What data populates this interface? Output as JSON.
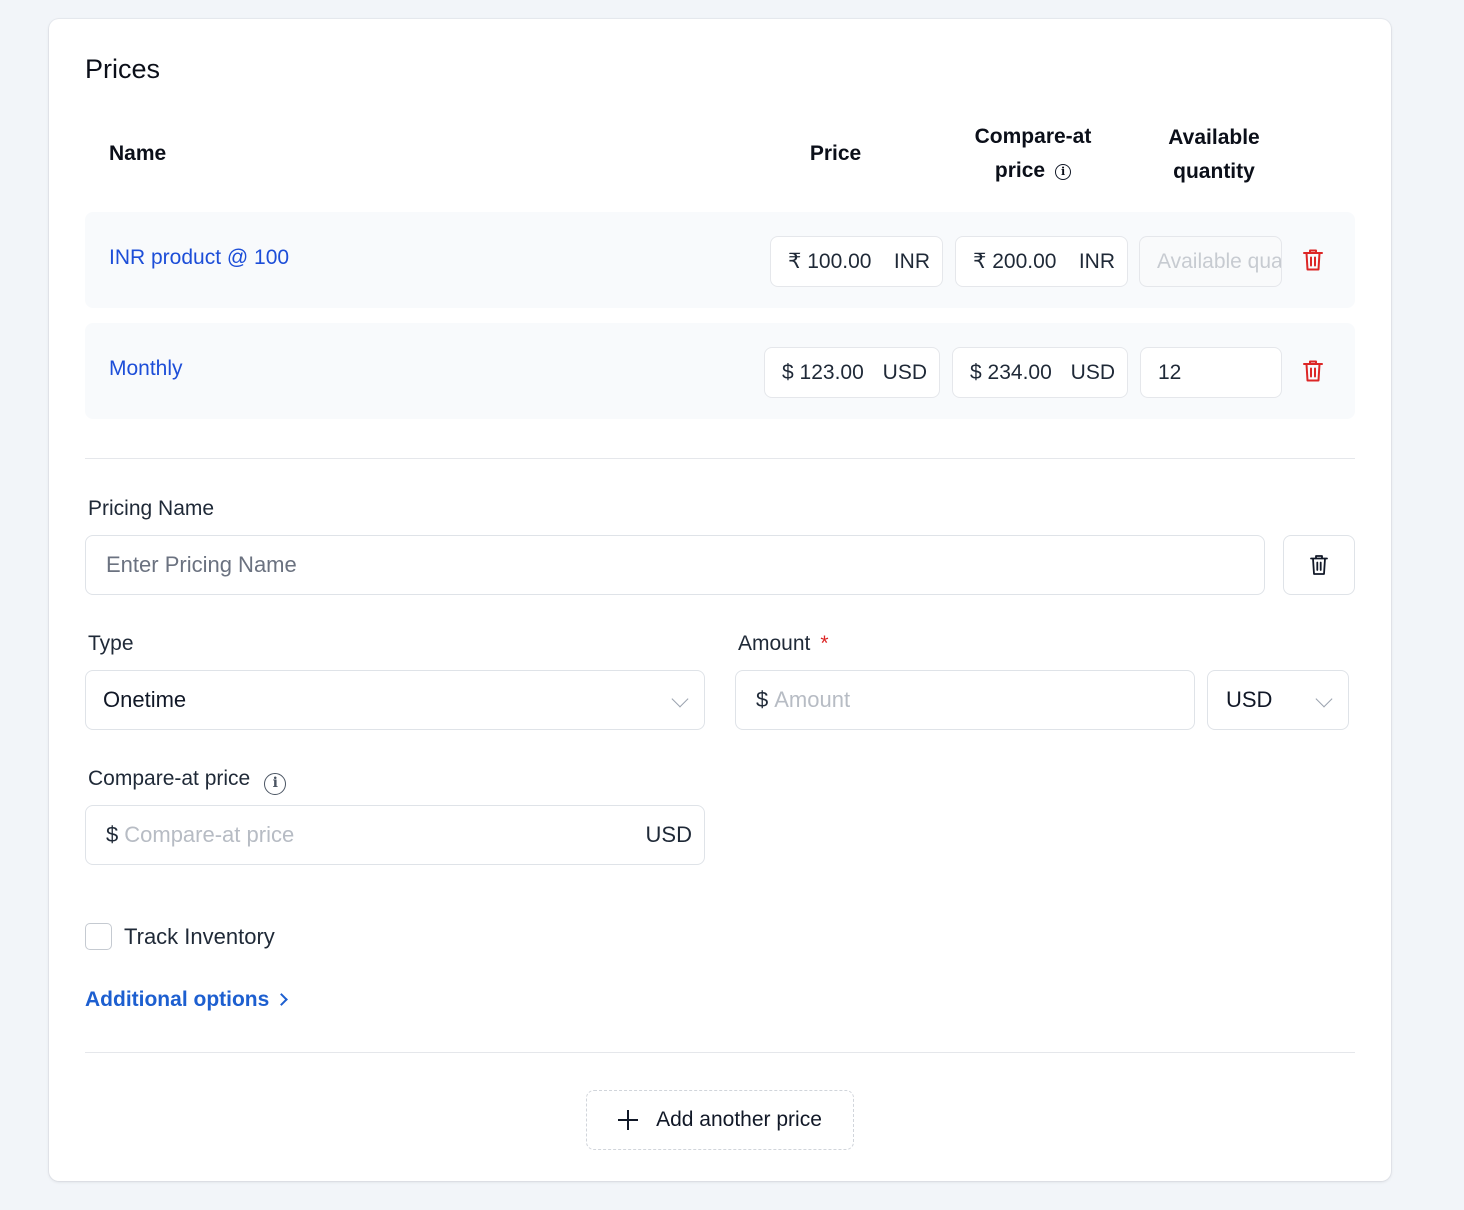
{
  "card": {
    "title": "Prices",
    "table": {
      "headers": {
        "name": "Name",
        "price": "Price",
        "compare_line1": "Compare-at",
        "compare_line2": "price",
        "avail_line1": "Available",
        "avail_line2": "quantity"
      },
      "rows": [
        {
          "name": "INR product @ 100",
          "price_symbol": "₹",
          "price": "100.00",
          "price_currency": "INR",
          "compare_symbol": "₹",
          "compare": "200.00",
          "compare_currency": "INR",
          "quantity": "",
          "quantity_placeholder": "Available quantity"
        },
        {
          "name": "Monthly",
          "price_symbol": "$",
          "price": "123.00",
          "price_currency": "USD",
          "compare_symbol": "$",
          "compare": "234.00",
          "compare_currency": "USD",
          "quantity": "12",
          "quantity_placeholder": ""
        }
      ]
    },
    "form": {
      "pricing_name_label": "Pricing Name",
      "pricing_name_placeholder": "Enter Pricing Name",
      "type_label": "Type",
      "type_value": "Onetime",
      "amount_label": "Amount",
      "amount_required_mark": "*",
      "amount_symbol": "$",
      "amount_placeholder": "Amount",
      "currency_value": "USD",
      "compare_label": "Compare-at price",
      "compare_symbol": "$",
      "compare_placeholder": "Compare-at price",
      "compare_currency": "USD",
      "track_inventory_label": "Track Inventory",
      "track_inventory_checked": false,
      "additional_options_label": "Additional options"
    },
    "add_price_label": "Add another price"
  },
  "colors": {
    "link": "#1d4ed8",
    "danger": "#dc2626",
    "background": "#f2f5f9"
  },
  "icons": [
    "info-icon",
    "trash-icon",
    "chevron-down-icon",
    "chevron-right-icon",
    "plus-icon"
  ]
}
